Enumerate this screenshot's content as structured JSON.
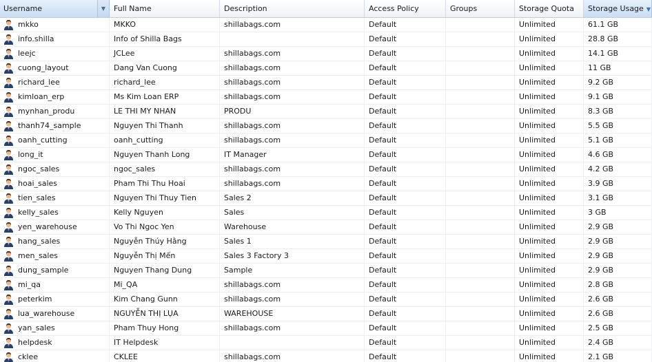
{
  "columns": {
    "username": "Username",
    "full_name": "Full Name",
    "description": "Description",
    "access_policy": "Access Policy",
    "groups": "Groups",
    "storage_quota": "Storage Quota",
    "storage_usage": "Storage Usage"
  },
  "sort": {
    "column": "storage_usage",
    "direction": "descending"
  },
  "icons": {
    "header_menu": "chevron-down-icon",
    "sort": "sort-desc-icon",
    "row": "user-icon"
  },
  "colors": {
    "active_header": "#c9ddf4",
    "sort_arrow": "#3a6fb5",
    "row_border": "#eceff2"
  },
  "rows": [
    {
      "username": "mkko",
      "full_name": "MKKO",
      "description": "shillabags.com",
      "policy": "Default",
      "groups": "",
      "quota": "Unlimited",
      "usage": "61.1 GB"
    },
    {
      "username": "info.shilla",
      "full_name": "Info of Shilla Bags",
      "description": "",
      "policy": "Default",
      "groups": "",
      "quota": "Unlimited",
      "usage": "28.8 GB"
    },
    {
      "username": "leejc",
      "full_name": "JCLee",
      "description": "shillabags.com",
      "policy": "Default",
      "groups": "",
      "quota": "Unlimited",
      "usage": "14.1 GB"
    },
    {
      "username": "cuong_layout",
      "full_name": "Dang Van Cuong",
      "description": "shillabags.com",
      "policy": "Default",
      "groups": "",
      "quota": "Unlimited",
      "usage": "11 GB"
    },
    {
      "username": "richard_lee",
      "full_name": "richard_lee",
      "description": "shillabags.com",
      "policy": "Default",
      "groups": "",
      "quota": "Unlimited",
      "usage": "9.2 GB"
    },
    {
      "username": "kimloan_erp",
      "full_name": "Ms Kim Loan ERP",
      "description": "shillabags.com",
      "policy": "Default",
      "groups": "",
      "quota": "Unlimited",
      "usage": "9.1 GB"
    },
    {
      "username": "mynhan_produ",
      "full_name": "LE THI MY NHAN",
      "description": "PRODU",
      "policy": "Default",
      "groups": "",
      "quota": "Unlimited",
      "usage": "8.3 GB"
    },
    {
      "username": "thanh74_sample",
      "full_name": "Nguyen Thi Thanh",
      "description": "shillabags.com",
      "policy": "Default",
      "groups": "",
      "quota": "Unlimited",
      "usage": "5.5 GB"
    },
    {
      "username": "oanh_cutting",
      "full_name": "oanh_cutting",
      "description": "shillabags.com",
      "policy": "Default",
      "groups": "",
      "quota": "Unlimited",
      "usage": "5.1 GB"
    },
    {
      "username": "long_it",
      "full_name": "Nguyen Thanh Long",
      "description": "IT Manager",
      "policy": "Default",
      "groups": "",
      "quota": "Unlimited",
      "usage": "4.6 GB"
    },
    {
      "username": "ngoc_sales",
      "full_name": "ngoc_sales",
      "description": "shillabags.com",
      "policy": "Default",
      "groups": "",
      "quota": "Unlimited",
      "usage": "4.2 GB"
    },
    {
      "username": "hoai_sales",
      "full_name": "Pham Thi Thu Hoai",
      "description": "shillabags.com",
      "policy": "Default",
      "groups": "",
      "quota": "Unlimited",
      "usage": "3.9 GB"
    },
    {
      "username": "tien_sales",
      "full_name": "Nguyen Thi Thuy Tien",
      "description": "Sales 2",
      "policy": "Default",
      "groups": "",
      "quota": "Unlimited",
      "usage": "3.1 GB"
    },
    {
      "username": "kelly_sales",
      "full_name": "Kelly Nguyen",
      "description": "Sales",
      "policy": "Default",
      "groups": "",
      "quota": "Unlimited",
      "usage": "3 GB"
    },
    {
      "username": "yen_warehouse",
      "full_name": "Vo Thi Ngoc Yen",
      "description": "Warehouse",
      "policy": "Default",
      "groups": "",
      "quota": "Unlimited",
      "usage": "2.9 GB"
    },
    {
      "username": "hang_sales",
      "full_name": "Nguyễn Thúy Hằng",
      "description": "Sales 1",
      "policy": "Default",
      "groups": "",
      "quota": "Unlimited",
      "usage": "2.9 GB"
    },
    {
      "username": "men_sales",
      "full_name": "Nguyễn Thị Mến",
      "description": "Sales 3 Factory 3",
      "policy": "Default",
      "groups": "",
      "quota": "Unlimited",
      "usage": "2.9 GB"
    },
    {
      "username": "dung_sample",
      "full_name": "Nguyen Thang Dung",
      "description": "Sample",
      "policy": "Default",
      "groups": "",
      "quota": "Unlimited",
      "usage": "2.9 GB"
    },
    {
      "username": "mi_qa",
      "full_name": "Mi_QA",
      "description": "shillabags.com",
      "policy": "Default",
      "groups": "",
      "quota": "Unlimited",
      "usage": "2.8 GB"
    },
    {
      "username": "peterkim",
      "full_name": "Kim Chang Gunn",
      "description": "shillabags.com",
      "policy": "Default",
      "groups": "",
      "quota": "Unlimited",
      "usage": "2.6 GB"
    },
    {
      "username": "lua_warehouse",
      "full_name": "NGUYỄN THỊ LỤA",
      "description": "WAREHOUSE",
      "policy": "Default",
      "groups": "",
      "quota": "Unlimited",
      "usage": "2.6 GB"
    },
    {
      "username": "yan_sales",
      "full_name": "Pham Thuy Hong",
      "description": "shillabags.com",
      "policy": "Default",
      "groups": "",
      "quota": "Unlimited",
      "usage": "2.5 GB"
    },
    {
      "username": "helpdesk",
      "full_name": "IT Helpdesk",
      "description": "",
      "policy": "Default",
      "groups": "",
      "quota": "Unlimited",
      "usage": "2.4 GB"
    },
    {
      "username": "cklee",
      "full_name": "CKLEE",
      "description": "shillabags.com",
      "policy": "Default",
      "groups": "",
      "quota": "Unlimited",
      "usage": "2.1 GB"
    }
  ]
}
